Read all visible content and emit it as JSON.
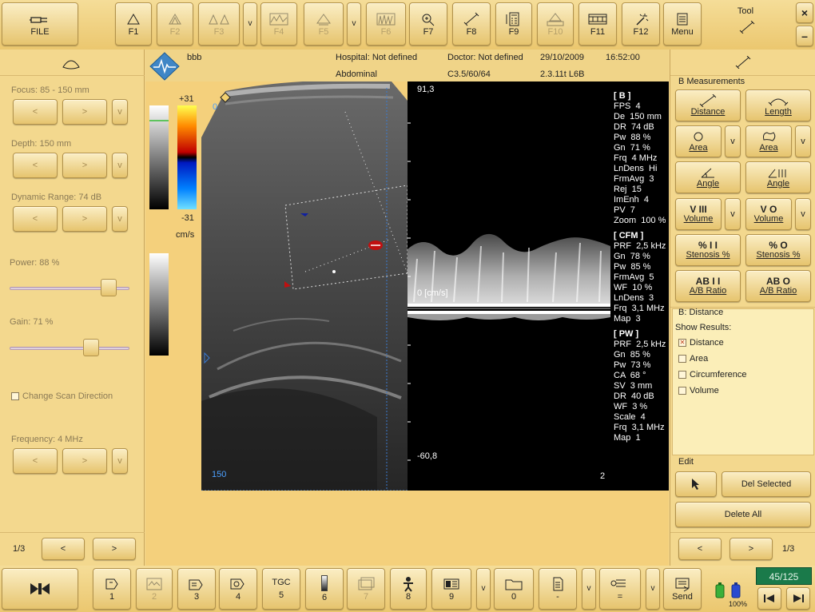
{
  "top": {
    "file_label": "FILE",
    "fkeys": [
      "F1",
      "F2",
      "F3",
      "F4",
      "F5",
      "F6",
      "F7",
      "F8",
      "F9",
      "F10",
      "F11",
      "F12"
    ],
    "v": "v",
    "menu": "Menu",
    "tool_label": "Tool",
    "close": "×",
    "minimize": "–"
  },
  "left": {
    "focus": "Focus: 85 - 150 mm",
    "depth": "Depth: 150 mm",
    "dyn_range": "Dynamic Range: 74 dB",
    "power": "Power: 88 %",
    "gain": "Gain: 71 %",
    "change_scan": "Change Scan Direction",
    "frequency": "Frequency: 4 MHz",
    "prev": "<",
    "next": ">",
    "v": "v",
    "page": "1/3",
    "power_level": 0.88,
    "gain_level": 0.71
  },
  "info": {
    "patient": "bbb",
    "hospital": "Hospital: Not defined",
    "doctor": "Doctor: Not defined",
    "date": "29/10/2009",
    "time": "16:52:00",
    "exam": "Abdominal",
    "probe": "C3.5/60/64",
    "version": "2.3.11t L6B"
  },
  "image": {
    "scale_top": "+31",
    "scale_bottom": "-31",
    "scale_unit": "cm/s",
    "depth_zero": "0",
    "depth_bottom": "150",
    "doppler_top": "91,3",
    "doppler_zero": "0 [cm/s]",
    "doppler_bottom": "-60,8",
    "frame_no": "2"
  },
  "params": {
    "b_head": "[ B ]",
    "b": [
      "FPS  4",
      "De  150 mm",
      "DR  74 dB",
      "Pw  88 %",
      "Gn  71 %",
      "Frq  4 MHz",
      "LnDens  Hi",
      "FrmAvg  3",
      "Rej  15",
      "ImEnh  4",
      "PV  7",
      "Zoom  100 %"
    ],
    "cfm_head": "[ CFM ]",
    "cfm": [
      "PRF  2,5 kHz",
      "Gn  78 %",
      "Pw  85 %",
      "FrmAvg  5",
      "WF  10 %",
      "LnDens  3",
      "Frq  3,1 MHz",
      "Map  3"
    ],
    "pw_head": "[ PW ]",
    "pw": [
      "PRF  2,5 kHz",
      "Gn  85 %",
      "Pw  73 %",
      "CA  68 °",
      "SV  3 mm",
      "DR  40 dB",
      "WF  3 %",
      "Scale  4",
      "Frq  3,1 MHz",
      "Map  1"
    ]
  },
  "right": {
    "group_b": "B Measurements",
    "distance": "Distance",
    "length": "Length",
    "area": "Area",
    "angle": "Angle",
    "volume": "Volume",
    "stenosis": "Stenosis %",
    "ab_ratio": "A/B Ratio",
    "v": "v",
    "vol_icon1": "V III",
    "vol_icon2": "V O",
    "sten_icon1": "% I I",
    "sten_icon2": "% O",
    "ab_icon1": "AB I I",
    "ab_icon2": "AB O",
    "group_dist": "B: Distance",
    "show_results": "Show Results:",
    "res_distance": "Distance",
    "res_area": "Area",
    "res_circ": "Circumference",
    "res_volume": "Volume",
    "group_edit": "Edit",
    "del_selected": "Del Selected",
    "delete_all": "Delete All",
    "prev": "<",
    "next": ">",
    "page": "1/3"
  },
  "bottom": {
    "keys": [
      "1",
      "2",
      "3",
      "4",
      "5",
      "6",
      "7",
      "8",
      "9",
      "0",
      "-",
      "="
    ],
    "tgc": "TGC",
    "send": "Send",
    "v": "v",
    "counter": "45/125",
    "battery": "100%"
  }
}
